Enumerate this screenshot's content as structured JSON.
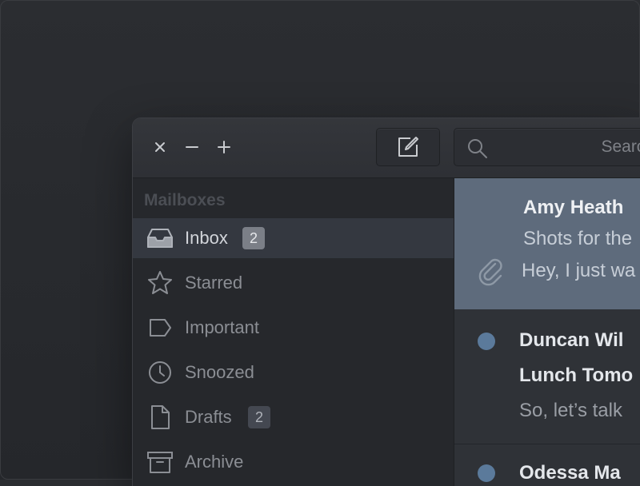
{
  "window_controls": {
    "close": "×",
    "minimize": "−",
    "maximize": "+"
  },
  "search": {
    "placeholder": "Search"
  },
  "sidebar": {
    "heading": "Mailboxes",
    "items": [
      {
        "label": "Inbox",
        "icon": "inbox-icon",
        "badge": "2",
        "active": true
      },
      {
        "label": "Starred",
        "icon": "star-icon"
      },
      {
        "label": "Important",
        "icon": "label-icon"
      },
      {
        "label": "Snoozed",
        "icon": "clock-icon"
      },
      {
        "label": "Drafts",
        "icon": "draft-icon",
        "badge": "2"
      },
      {
        "label": "Archive",
        "icon": "archive-icon"
      }
    ]
  },
  "messages": [
    {
      "sender": "Amy Heath",
      "subject": "Shots for the",
      "preview": "Hey, I just wa",
      "selected": true,
      "attachment": true
    },
    {
      "sender": "Duncan Wil",
      "subject": "Lunch Tomo",
      "preview": "So, let’s talk",
      "unread": true
    },
    {
      "sender": "Odessa Ma",
      "unread": true
    }
  ],
  "colors": {
    "selected_row": "#5e6b7c",
    "unread_dot": "#5b7a9b",
    "sidebar_active": "#343840"
  }
}
